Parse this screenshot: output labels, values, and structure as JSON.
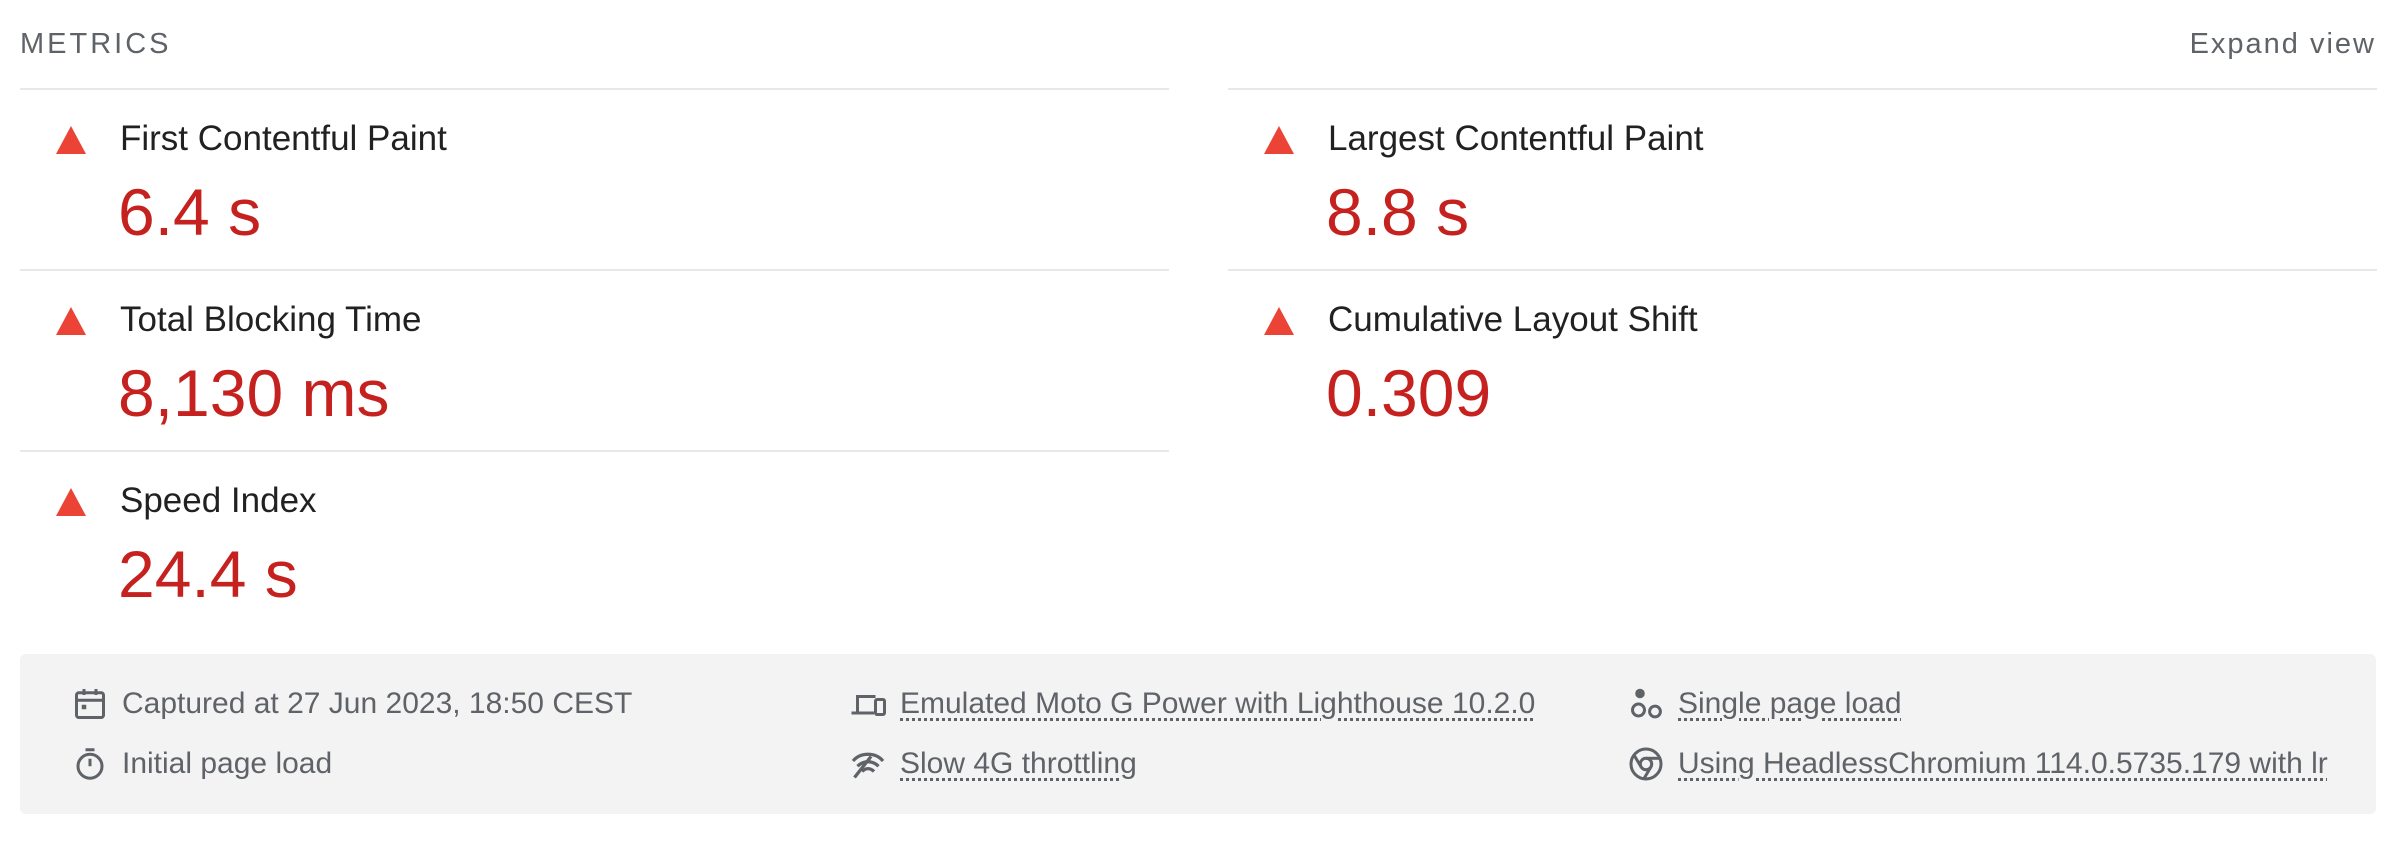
{
  "header": {
    "title": "METRICS",
    "expand_label": "Expand view"
  },
  "metrics": {
    "fcp": {
      "label": "First Contentful Paint",
      "value": "6.4 s",
      "status": "fail"
    },
    "lcp": {
      "label": "Largest Contentful Paint",
      "value": "8.8 s",
      "status": "fail"
    },
    "tbt": {
      "label": "Total Blocking Time",
      "value": "8,130 ms",
      "status": "fail"
    },
    "cls": {
      "label": "Cumulative Layout Shift",
      "value": "0.309",
      "status": "fail"
    },
    "si": {
      "label": "Speed Index",
      "value": "24.4 s",
      "status": "fail"
    }
  },
  "footer": {
    "captured": "Captured at 27 Jun 2023, 18:50 CEST",
    "initial_load": "Initial page load",
    "device": "Emulated Moto G Power with Lighthouse 10.2.0",
    "throttling": "Slow 4G throttling",
    "page_load": "Single page load",
    "browser": "Using HeadlessChromium 114.0.5735.179 with lr"
  },
  "colors": {
    "fail": "#eb4335",
    "fail_text": "#c5221f",
    "muted": "#5f6368"
  },
  "icons": {
    "status": "fail-triangle-icon",
    "captured": "calendar-icon",
    "initial_load": "stopwatch-icon",
    "device": "devices-icon",
    "throttling": "network-signal-icon",
    "page_load": "circles-icon",
    "browser": "chrome-icon"
  }
}
